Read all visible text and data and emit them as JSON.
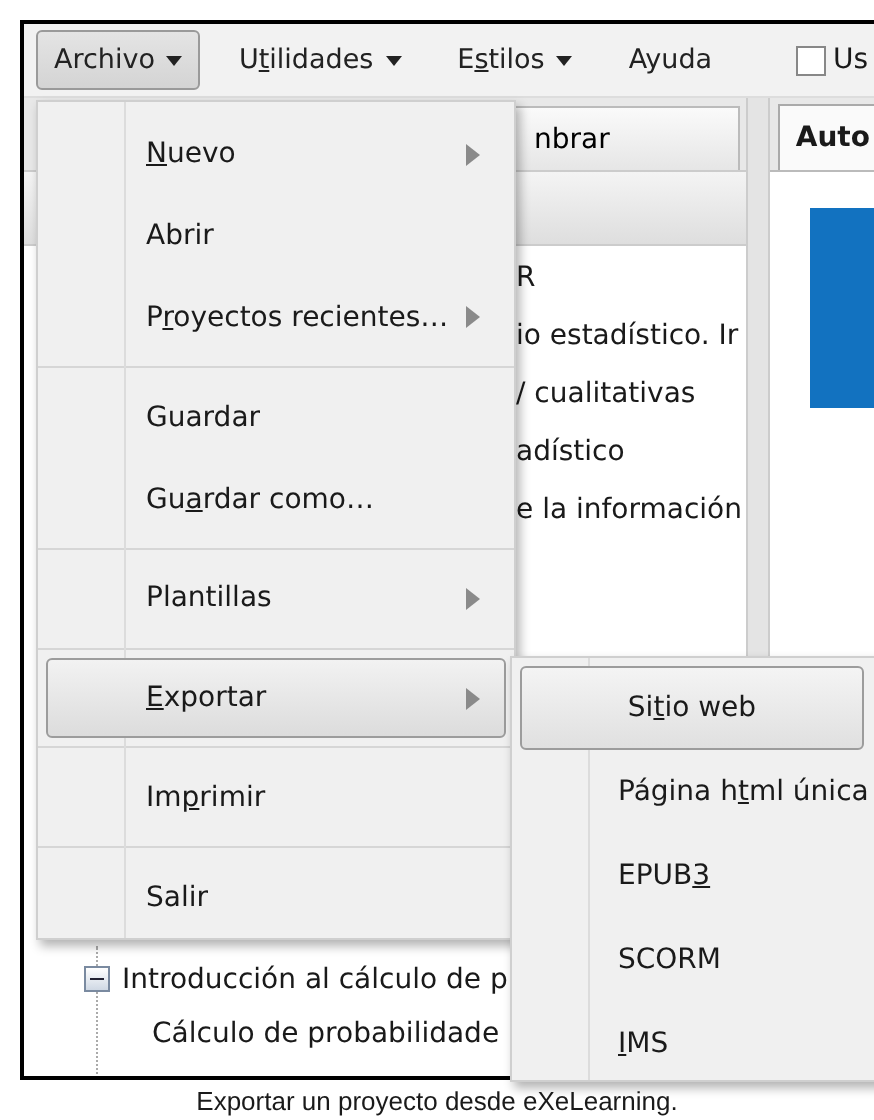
{
  "menubar": [
    {
      "label": "Archivo",
      "dropdown": true,
      "selected": true
    },
    {
      "label": {
        "pre": "U",
        "key": "t",
        "post": "ilidades"
      },
      "dropdown": true,
      "selected": false
    },
    {
      "label": {
        "pre": "E",
        "key": "s",
        "post": "tilos"
      },
      "dropdown": true,
      "selected": false
    },
    {
      "label": "Ayuda",
      "dropdown": false,
      "selected": false
    }
  ],
  "toolbar_checkbox": {
    "label": "Us",
    "checked": false
  },
  "left_panel": {
    "button": "nbrar",
    "tree_top": [
      "R",
      "io estadístico. Ir",
      "/ cualitativas",
      "adístico",
      "e la información"
    ],
    "tree_bottom": [
      {
        "label": "Introducción al cálculo de p",
        "expanded": true,
        "children": [
          {
            "label": "Cálculo de probabilidade"
          }
        ]
      }
    ]
  },
  "right_panel": {
    "tab": "Auto"
  },
  "file_menu": [
    {
      "kind": "item",
      "label": {
        "key": "N",
        "post": "uevo"
      },
      "submenu": true,
      "selected": false
    },
    {
      "kind": "item",
      "label": "Abrir",
      "submenu": false,
      "selected": false
    },
    {
      "kind": "item",
      "label": {
        "pre": "P",
        "key": "r",
        "post": "oyectos recientes…"
      },
      "submenu": true,
      "selected": false
    },
    {
      "kind": "separator"
    },
    {
      "kind": "item",
      "label": "Guardar",
      "submenu": false,
      "selected": false
    },
    {
      "kind": "item",
      "label": {
        "pre": "Gu",
        "key": "a",
        "post": "rdar como…"
      },
      "submenu": false,
      "selected": false
    },
    {
      "kind": "separator"
    },
    {
      "kind": "item",
      "label": "Plantillas",
      "submenu": true,
      "selected": false
    },
    {
      "kind": "separator"
    },
    {
      "kind": "item",
      "label": {
        "key": "E",
        "post": "xportar"
      },
      "submenu": true,
      "selected": true
    },
    {
      "kind": "separator"
    },
    {
      "kind": "item",
      "label": {
        "pre": "Im",
        "key": "p",
        "post": "rimir"
      },
      "submenu": false,
      "selected": false
    },
    {
      "kind": "separator"
    },
    {
      "kind": "item",
      "label": "Salir",
      "submenu": false,
      "selected": false
    }
  ],
  "export_submenu": [
    {
      "label": {
        "pre": "Si",
        "key": "t",
        "post": "io web"
      },
      "selected": true
    },
    {
      "label": {
        "pre": "Página h",
        "key": "t",
        "post": "ml única"
      },
      "selected": false
    },
    {
      "label": {
        "pre": "EPUB",
        "key": "3"
      },
      "selected": false
    },
    {
      "label": "SCORM",
      "selected": false
    },
    {
      "label": {
        "key": "I",
        "post": "MS"
      },
      "selected": false
    }
  ],
  "caption": "Exportar un proyecto desde eXeLearning."
}
